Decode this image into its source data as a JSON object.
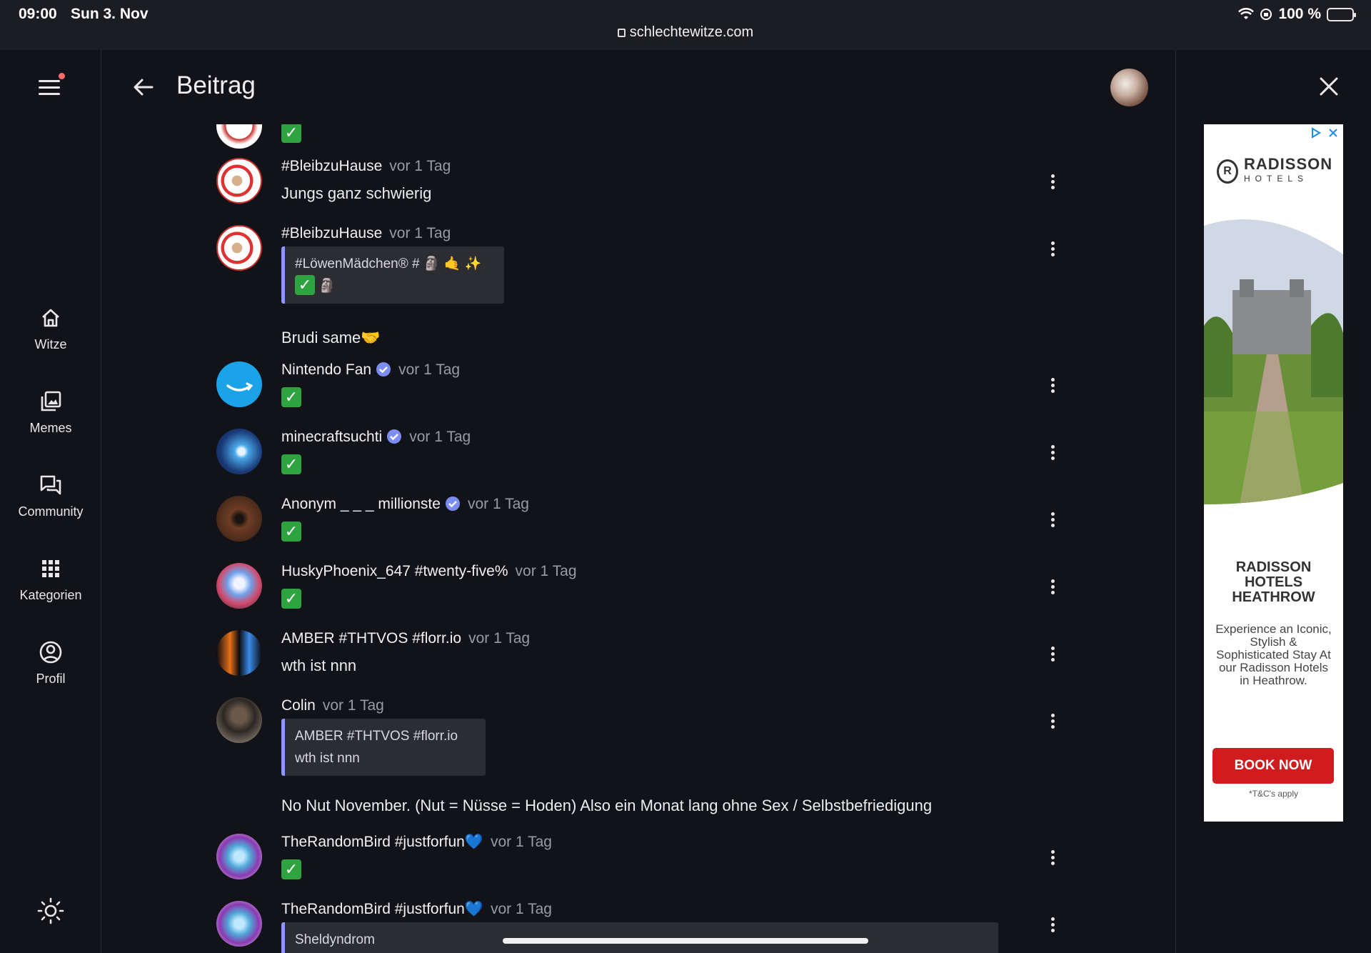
{
  "status_bar": {
    "time": "09:00",
    "date": "Sun 3. Nov",
    "url": "schlechtewitze.com",
    "battery": "100 %"
  },
  "sidebar": {
    "items": [
      {
        "label": "Witze",
        "icon": "home-icon"
      },
      {
        "label": "Memes",
        "icon": "image-gallery-icon"
      },
      {
        "label": "Community",
        "icon": "chat-bubbles-icon"
      },
      {
        "label": "Kategorien",
        "icon": "grid-icon"
      },
      {
        "label": "Profil",
        "icon": "account-circle-icon"
      }
    ],
    "theme_icon": "sun-icon"
  },
  "header": {
    "title": "Beitrag"
  },
  "comments": [
    {
      "name": "#BleibzuHause",
      "time": "vor 1 Tag",
      "text": "Jungs ganz schwierig"
    },
    {
      "name": "#BleibzuHause",
      "time": "vor 1 Tag",
      "quote_line1": "#LöwenMädchen® # 🗿 🤙 ✨",
      "quote_line2": "🗿",
      "text": "Brudi same🤝"
    },
    {
      "name": "Nintendo Fan",
      "time": "vor 1 Tag",
      "text": "✅"
    },
    {
      "name": "minecraftsuchti",
      "time": "vor 1 Tag",
      "text": "✅"
    },
    {
      "name": "Anonym _ _ _ millionste",
      "time": "vor 1 Tag",
      "text": "✅"
    },
    {
      "name": "HuskyPhoenix_647 #twenty-five%",
      "time": "vor 1 Tag",
      "text": "✅"
    },
    {
      "name": "AMBER #THTVOS #florr.io",
      "time": "vor 1 Tag",
      "text": "wth ist nnn"
    },
    {
      "name": "Colin",
      "time": "vor 1 Tag",
      "quote_line1": "AMBER #THTVOS #florr.io",
      "quote_line2": "wth ist nnn",
      "text": "No Nut November. (Nut = Nüsse = Hoden) Also ein Monat lang ohne Sex / Selbstbefriedigung"
    },
    {
      "name": "TheRandomBird #justforfun💙",
      "time": "vor 1 Tag",
      "text": "✅"
    },
    {
      "name": "TheRandomBird #justforfun💙",
      "time": "vor 1 Tag",
      "quote_line1": "Sheldyndrom"
    }
  ],
  "ad": {
    "brand": "RADISSON",
    "brand_sub": "HOTELS",
    "headline_1": "RADISSON",
    "headline_2": "HOTELS",
    "headline_3": "HEATHROW",
    "body": "Experience an Iconic, Stylish & Sophisticated Stay At our Radisson Hotels in Heathrow.",
    "cta": "BOOK NOW",
    "terms": "*T&C's apply"
  }
}
